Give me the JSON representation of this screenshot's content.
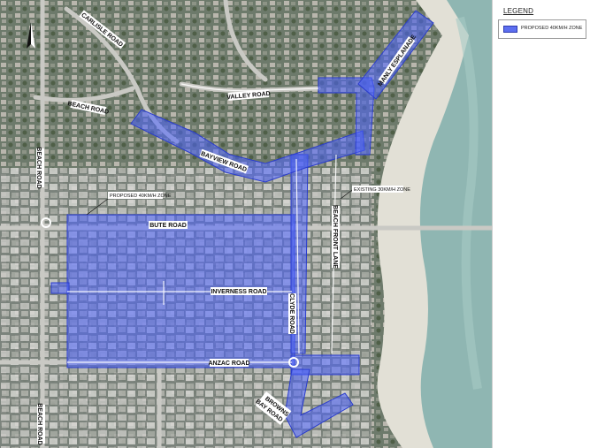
{
  "map": {
    "north_icon": "north-arrow-icon",
    "colors": {
      "proposed_zone_fill": "#4d63ff",
      "proposed_zone_stroke": "#2a3ccc",
      "land": "#6f7a70",
      "beach": "#e2e0d6",
      "sea": "#8fb6b2",
      "road": "#c9c9c4"
    },
    "labels": {
      "carlisle_road": "CARLISLE ROAD",
      "beach_road_top": "BEACH ROAD",
      "beach_road_left": "BEACH ROAD",
      "beach_road_bottom": "BEACH ROAD",
      "valley_road": "VALLEY ROAD",
      "manly_esplanade": "MANLY ESPLANADE",
      "bayview_road": "BAYVIEW ROAD",
      "bute_road": "BUTE ROAD",
      "inverness_road": "INVERNESS ROAD",
      "clyde_road": "CLYDE ROAD",
      "anzac_road": "ANZAC ROAD",
      "beach_front_lane": "BEACH FRONT LANE",
      "browns_bay_road_1": "BROWNS",
      "browns_bay_road_2": "BAY ROAD"
    },
    "annotations": {
      "proposed_zone": "PROPOSED 40KM/H ZONE",
      "existing_zone": "EXISTING 30KM/H ZONE"
    }
  },
  "legend": {
    "title": "LEGEND",
    "item_label": "PROPOSED 40KM/H ZONE",
    "swatch_color": "#5d6ff0"
  }
}
